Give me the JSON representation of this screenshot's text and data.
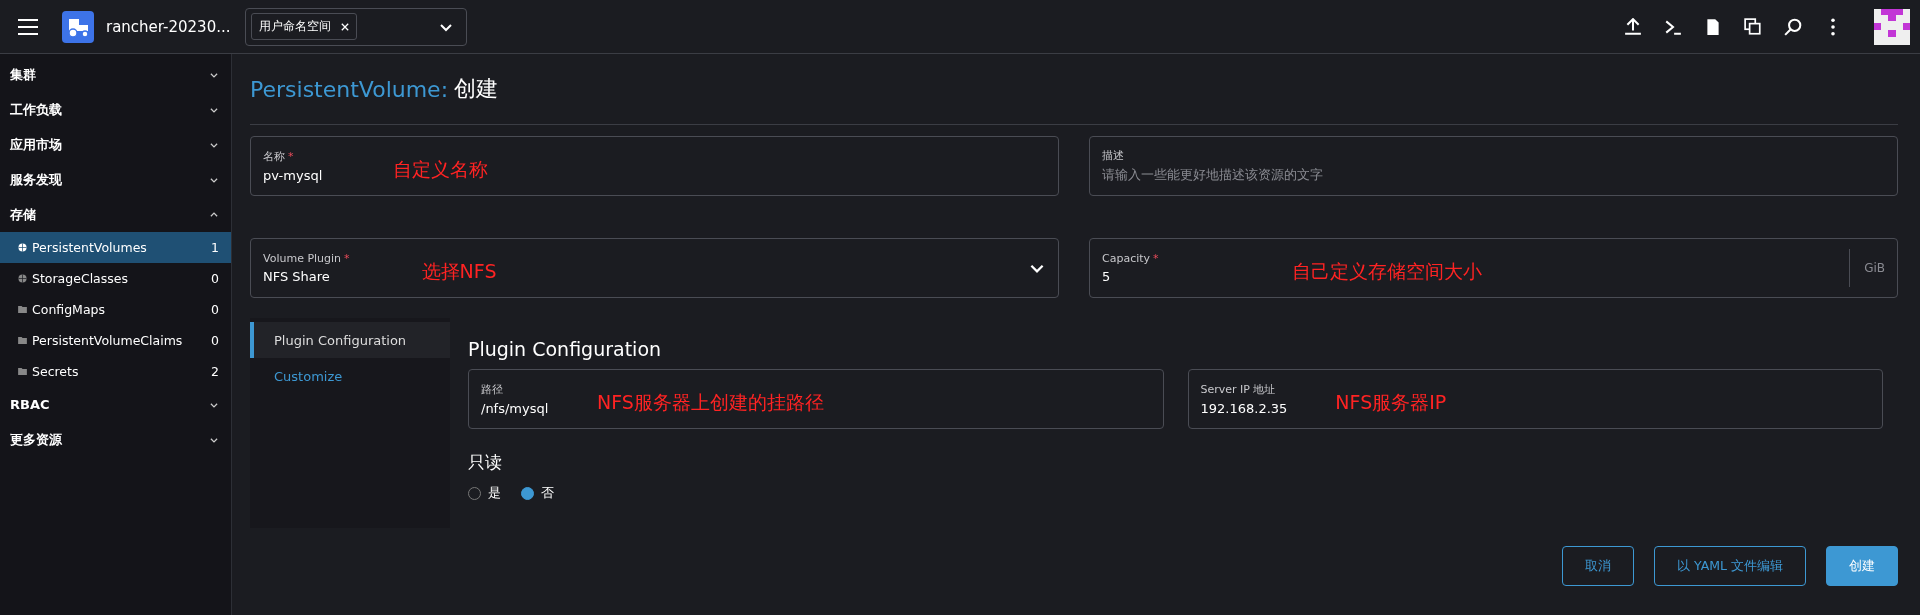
{
  "header": {
    "cluster": "rancher-20230...",
    "namespace_chip": "用户命名空间"
  },
  "sidebar": {
    "groups": [
      {
        "label": "集群",
        "expanded": false
      },
      {
        "label": "工作负载",
        "expanded": false
      },
      {
        "label": "应用市场",
        "expanded": false
      },
      {
        "label": "服务发现",
        "expanded": false
      },
      {
        "label": "存储",
        "expanded": true,
        "children": [
          {
            "label": "PersistentVolumes",
            "count": "1",
            "kind": "globe",
            "selected": true
          },
          {
            "label": "StorageClasses",
            "count": "0",
            "kind": "globe",
            "selected": false
          },
          {
            "label": "ConfigMaps",
            "count": "0",
            "kind": "folder",
            "selected": false
          },
          {
            "label": "PersistentVolumeClaims",
            "count": "0",
            "kind": "folder",
            "selected": false
          },
          {
            "label": "Secrets",
            "count": "2",
            "kind": "folder",
            "selected": false
          }
        ]
      },
      {
        "label": "RBAC",
        "expanded": false
      },
      {
        "label": "更多资源",
        "expanded": false
      }
    ]
  },
  "page": {
    "title_resource": "PersistentVolume:",
    "title_action": "创建"
  },
  "fields_row_1": [
    {
      "label": "名称",
      "required_mark": "*",
      "value": "pv-mysql",
      "annotation": "自定义名称"
    },
    {
      "label": "描述",
      "placeholder": "请输入一些能更好地描述该资源的文字"
    }
  ],
  "fields_row_2": [
    {
      "kind": "select",
      "label": "Volume Plugin",
      "required_mark": "*",
      "value": "NFS Share",
      "annotation": "选择NFS"
    },
    {
      "kind": "unit",
      "label": "Capacity",
      "required_mark": "*",
      "value": "5",
      "unit": "GiB",
      "annotation": "自己定义存储空间大小"
    }
  ],
  "plugin_tabs": [
    {
      "label": "Plugin Configuration",
      "selected": true
    },
    {
      "label": "Customize",
      "selected": false
    }
  ],
  "plugin_config": {
    "heading": "Plugin Configuration",
    "fields": [
      {
        "label": "路径",
        "value": "/nfs/mysql",
        "annotation": "NFS服务器上创建的挂路径"
      },
      {
        "label": "Server IP 地址",
        "value": "192.168.2.35",
        "annotation": "NFS服务器IP"
      }
    ],
    "readonly_label": "只读",
    "readonly_options": [
      {
        "label": "是",
        "selected": false
      },
      {
        "label": "否",
        "selected": true
      }
    ]
  },
  "buttons": [
    {
      "label": "取消",
      "kind": "outline"
    },
    {
      "label": "以 YAML 文件编辑",
      "kind": "outline"
    },
    {
      "label": "创建",
      "kind": "primary"
    }
  ]
}
